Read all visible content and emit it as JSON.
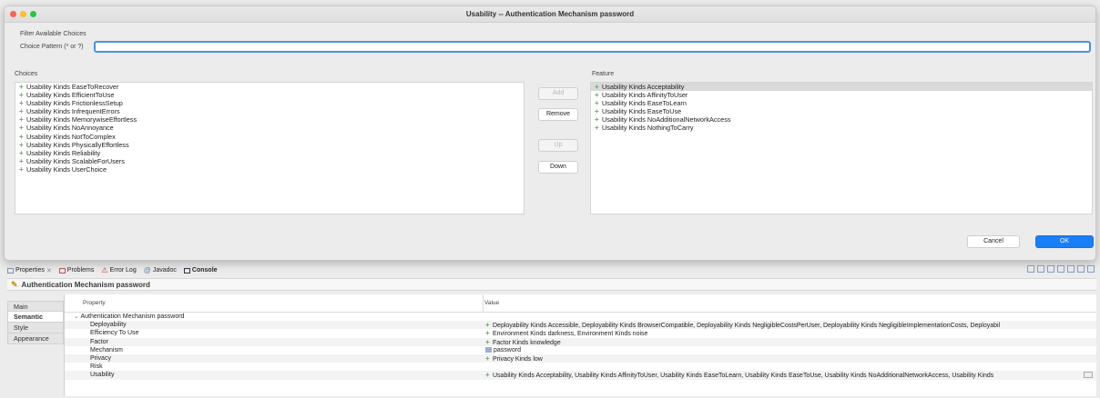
{
  "dialog": {
    "title": "Usability -- Authentication Mechanism password",
    "filter_section_label": "Filter Available Choices",
    "choice_pattern_label": "Choice Pattern (* or ?)",
    "choice_pattern_value": "",
    "choices_label": "Choices",
    "feature_label": "Feature",
    "choices": [
      "Usability Kinds EaseToRecover",
      "Usability Kinds EfficientToUse",
      "Usability Kinds FrictionlessSetup",
      "Usability Kinds InfrequentErrors",
      "Usability Kinds MemorywiseEffortless",
      "Usability Kinds NoAnnoyance",
      "Usability Kinds NotToComplex",
      "Usability Kinds PhysicallyEffortless",
      "Usability Kinds Reliability",
      "Usability Kinds ScalableForUsers",
      "Usability Kinds UserChoice"
    ],
    "features": [
      "Usability Kinds Acceptability",
      "Usability Kinds AffinityToUser",
      "Usability Kinds EaseToLearn",
      "Usability Kinds EaseToUse",
      "Usability Kinds NoAdditionalNetworkAccess",
      "Usability Kinds NothingToCarry"
    ],
    "buttons": {
      "add": "Add",
      "remove": "Remove",
      "up": "Up",
      "down": "Down",
      "cancel": "Cancel",
      "ok": "OK"
    }
  },
  "views": {
    "tabs": [
      "Properties",
      "Problems",
      "Error Log",
      "Javadoc",
      "Console"
    ],
    "active_tab": "Console"
  },
  "properties": {
    "header_title": "Authentication Mechanism password",
    "side_tabs": [
      "Main",
      "Semantic",
      "Style",
      "Appearance"
    ],
    "active_side_tab": "Semantic",
    "col_property": "Property",
    "col_value": "Value",
    "root_label": "Authentication Mechanism password",
    "rows": [
      {
        "name": "Deployability",
        "value": "Deployability Kinds Accessible, Deployability Kinds BrowserCompatible, Deployability Kinds NegligibleCostsPerUser, Deployability Kinds NegligibleImplementationCosts, Deployabil"
      },
      {
        "name": "Efficiency To Use",
        "value": "Environment Kinds darkness, Environment Kinds noise"
      },
      {
        "name": "Factor",
        "value": "Factor Kinds knowledge"
      },
      {
        "name": "Mechanism",
        "value": "password"
      },
      {
        "name": "Privacy",
        "value": "Privacy Kinds low"
      },
      {
        "name": "Risk",
        "value": ""
      },
      {
        "name": "Usability",
        "value": "Usability Kinds Acceptability, Usability Kinds AffinityToUser, Usability Kinds EaseToLearn, Usability Kinds EaseToUse, Usability Kinds NoAdditionalNetworkAccess, Usability Kinds"
      }
    ]
  },
  "colors": {
    "accent": "#1a7ff6",
    "focus_ring": "#4a90e2",
    "close": "#ff5f57",
    "minimize": "#febc2e",
    "zoom": "#28c840",
    "plus_icon": "#6aaa64"
  }
}
